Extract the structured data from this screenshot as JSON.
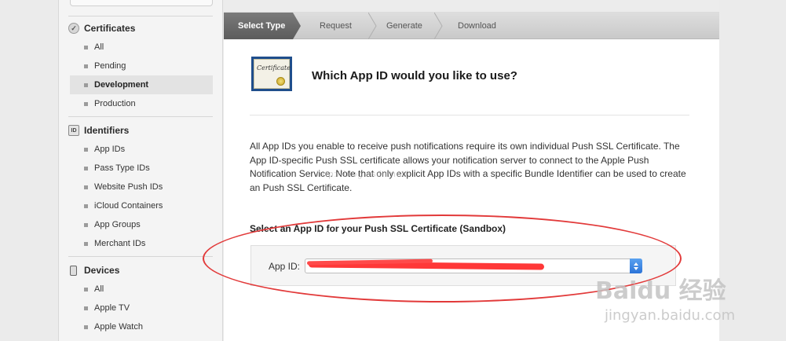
{
  "sidebar": {
    "sections": [
      {
        "title": "Certificates",
        "icon": "certificate-icon",
        "items": [
          {
            "label": "All"
          },
          {
            "label": "Pending"
          },
          {
            "label": "Development",
            "active": true
          },
          {
            "label": "Production"
          }
        ]
      },
      {
        "title": "Identifiers",
        "icon": "id-icon",
        "items": [
          {
            "label": "App IDs"
          },
          {
            "label": "Pass Type IDs"
          },
          {
            "label": "Website Push IDs"
          },
          {
            "label": "iCloud Containers"
          },
          {
            "label": "App Groups"
          },
          {
            "label": "Merchant IDs"
          }
        ]
      },
      {
        "title": "Devices",
        "icon": "device-icon",
        "items": [
          {
            "label": "All"
          },
          {
            "label": "Apple TV"
          },
          {
            "label": "Apple Watch"
          }
        ]
      }
    ]
  },
  "steps": [
    {
      "label": "Select Type",
      "active": true
    },
    {
      "label": "Request"
    },
    {
      "label": "Generate"
    },
    {
      "label": "Download"
    }
  ],
  "main": {
    "heading": "Which App ID would you like to use?",
    "description": "All App IDs you enable to receive push notifications require its own individual Push SSL Certificate. The App ID-specific Push SSL certificate allows your notification server to connect to the Apple Push Notification Service. Note that only explicit App IDs with a specific Bundle Identifier can be used to create an Push SSL Certificate.",
    "select_label": "Select an App ID for your Push SSL Certificate (Sandbox)",
    "app_id_label": "App ID:",
    "app_id_value": ""
  },
  "watermark": {
    "url": "http://blog.csdn.net/",
    "logo": "Baidu 经验",
    "site": "jingyan.baidu.com"
  },
  "colors": {
    "active_step": "#636363",
    "annotation": "#e23a3a",
    "select_stepper": "#2c74d8"
  }
}
